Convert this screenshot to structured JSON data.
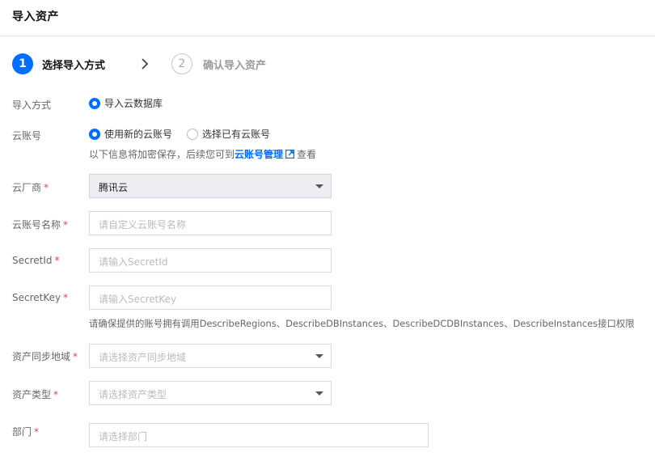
{
  "header": {
    "title": "导入资产"
  },
  "steps": [
    {
      "number": "1",
      "label": "选择导入方式"
    },
    {
      "number": "2",
      "label": "确认导入资产"
    }
  ],
  "form": {
    "import_method": {
      "label": "导入方式",
      "option": "导入云数据库"
    },
    "cloud_account": {
      "label": "云账号",
      "options": [
        "使用新的云账号",
        "选择已有云账号"
      ],
      "hint_prefix": "以下信息将加密保存，后续您可到",
      "hint_link": "云账号管理",
      "hint_suffix": "查看"
    },
    "vendor": {
      "label": "云厂商",
      "value": "腾讯云"
    },
    "account_name": {
      "label": "云账号名称",
      "placeholder": "请自定义云账号名称"
    },
    "secret_id": {
      "label": "SecretId",
      "placeholder": "请输入SecretId"
    },
    "secret_key": {
      "label": "SecretKey",
      "placeholder": "请输入SecretKey",
      "hint": "请确保提供的账号拥有调用DescribeRegions、DescribeDBInstances、DescribeDCDBInstances、DescribeInstances接口权限"
    },
    "sync_region": {
      "label": "资产同步地域",
      "placeholder": "请选择资产同步地域"
    },
    "asset_type": {
      "label": "资产类型",
      "placeholder": "请选择资产类型"
    },
    "department": {
      "label": "部门",
      "placeholder": "请选择部门"
    }
  },
  "required_mark": "*",
  "colors": {
    "accent": "#006eff",
    "required": "#e54545"
  },
  "icons": [
    "chevron-right-icon",
    "external-link-icon",
    "caret-down-icon"
  ]
}
